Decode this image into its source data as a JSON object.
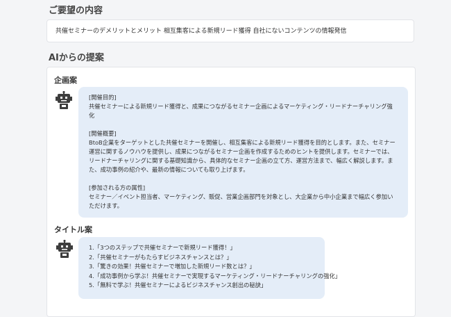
{
  "request": {
    "heading": "ご要望の内容",
    "text": "共催セミナーのデメリットとメリット 相互集客による新規リード獲得 自社にないコンテンツの情報発信"
  },
  "ai": {
    "heading": "AIからの提案",
    "plan": {
      "heading": "企画案",
      "purpose_label": "[開催目的]",
      "purpose_text": "共催セミナーによる新規リード獲得と、成果につながるセミナー企画によるマーケティング・リードナーチャリング強化",
      "overview_label": "[開催概要]",
      "overview_text": "BtoB企業をターゲットとした共催セミナーを開催し、相互集客による新規リード獲得を目的とします。また、セミナー運営に関するノウハウを提供し、成果につながるセミナー企画を作成するためのヒントを提供します。セミナーでは、リードナーチャリングに関する基礎知識から、具体的なセミナー企画の立て方、運営方法まで、幅広く解説します。また、成功事例の紹介や、最新の情報についても取り上げます。",
      "audience_label": "[参加される方の属性]",
      "audience_text": "セミナー／イベント担当者、マーケティング、販促、営業企画部門を対象とし、大企業から中小企業まで幅広く参加いただけます。"
    },
    "titles": {
      "heading": "タイトル案",
      "items": [
        "1.「3つのステップで共催セミナーで新規リード獲得！」",
        "2.「共催セミナーがもたらすビジネスチャンスとは？」",
        "3.「驚きの効果！共催セミナーで増加した新規リード数とは？」",
        "4.「成功事例から学ぶ！共催セミナーで実現するマーケティング・リードナーチャリングの強化」",
        "5.「無料で学ぶ！共催セミナーによるビジネスチャンス創出の秘訣」"
      ]
    }
  },
  "icons": {
    "robot": "robot-icon"
  }
}
